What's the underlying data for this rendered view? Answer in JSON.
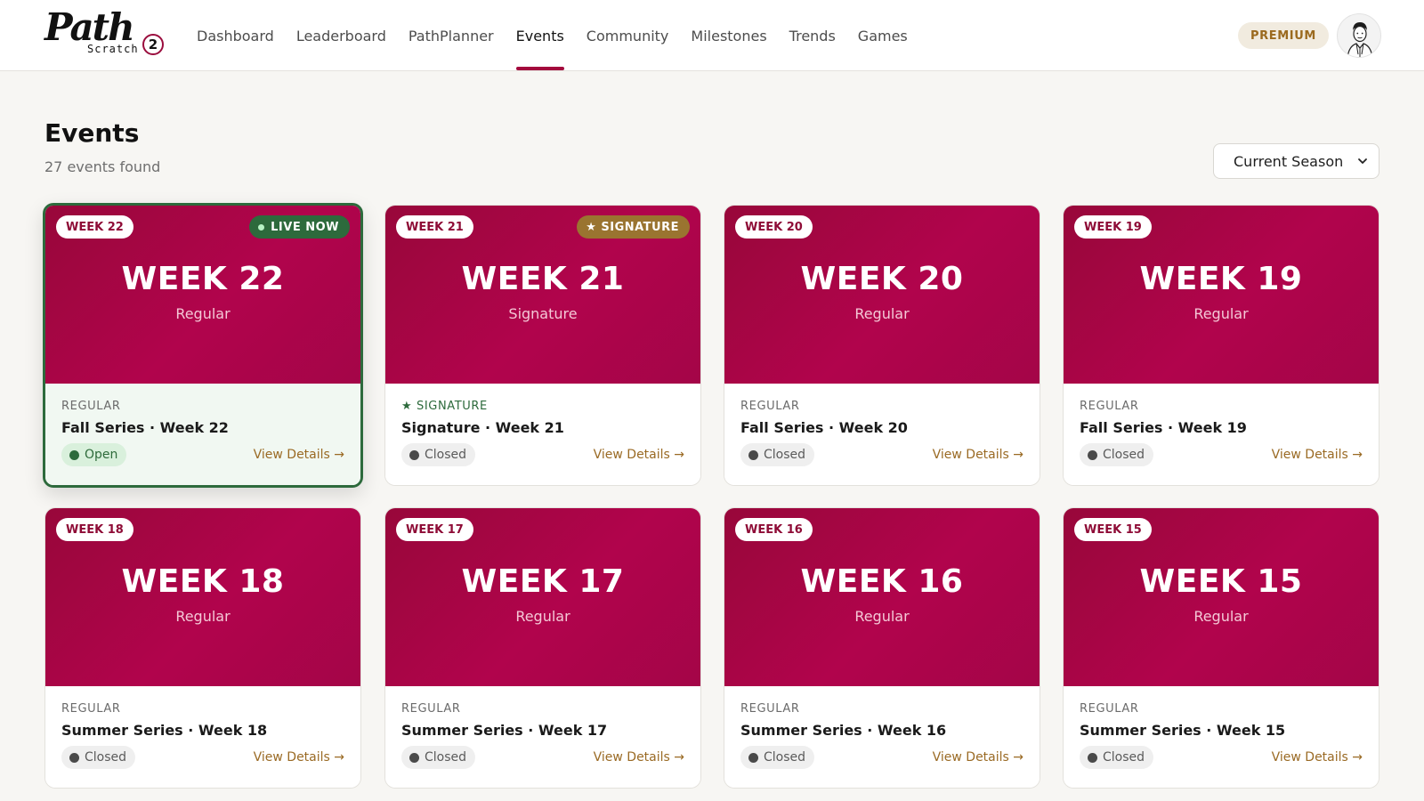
{
  "header": {
    "logo": {
      "script": "Path",
      "sub": "Scratch",
      "badge": "2"
    },
    "nav": [
      "Dashboard",
      "Leaderboard",
      "PathPlanner",
      "Events",
      "Community",
      "Milestones",
      "Trends",
      "Games"
    ],
    "active_nav": "Events",
    "premium_label": "PREMIUM"
  },
  "page": {
    "title": "Events",
    "count": "27 events found",
    "season_select": {
      "value": "Current Season"
    }
  },
  "cards": [
    {
      "pill": "WEEK 22",
      "banner_week": "WEEK 22",
      "banner_type": "Regular",
      "type_label": "REGULAR",
      "title": "Fall Series · Week 22",
      "status": "Open",
      "badge": "LIVE NOW",
      "details": "View Details →"
    },
    {
      "pill": "WEEK 21",
      "banner_week": "WEEK 21",
      "banner_type": "Signature",
      "type_label": "SIGNATURE",
      "title": "Signature · Week 21",
      "status": "Closed",
      "badge": "SIGNATURE",
      "details": "View Details →"
    },
    {
      "pill": "WEEK 20",
      "banner_week": "WEEK 20",
      "banner_type": "Regular",
      "type_label": "REGULAR",
      "title": "Fall Series · Week 20",
      "status": "Closed",
      "details": "View Details →"
    },
    {
      "pill": "WEEK 19",
      "banner_week": "WEEK 19",
      "banner_type": "Regular",
      "type_label": "REGULAR",
      "title": "Fall Series · Week 19",
      "status": "Closed",
      "details": "View Details →"
    },
    {
      "pill": "WEEK 18",
      "banner_week": "WEEK 18",
      "banner_type": "Regular",
      "type_label": "REGULAR",
      "title": "Summer Series · Week 18",
      "status": "Closed",
      "details": "View Details →"
    },
    {
      "pill": "WEEK 17",
      "banner_week": "WEEK 17",
      "banner_type": "Regular",
      "type_label": "REGULAR",
      "title": "Summer Series · Week 17",
      "status": "Closed",
      "details": "View Details →"
    },
    {
      "pill": "WEEK 16",
      "banner_week": "WEEK 16",
      "banner_type": "Regular",
      "type_label": "REGULAR",
      "title": "Summer Series · Week 16",
      "status": "Closed",
      "details": "View Details →"
    },
    {
      "pill": "WEEK 15",
      "banner_week": "WEEK 15",
      "banner_type": "Regular",
      "type_label": "REGULAR",
      "title": "Summer Series · Week 15",
      "status": "Closed",
      "details": "View Details →"
    }
  ],
  "colors": {
    "brand": "#a3093d",
    "banner": "#a60546",
    "live_green": "#2d6a3c",
    "signature_gold": "#9a7430",
    "premium_text": "#9b6a1f"
  },
  "icons": [
    "chevron-down-icon",
    "star-icon",
    "live-dot-icon",
    "arrow-right-icon",
    "avatar-illustration"
  ]
}
